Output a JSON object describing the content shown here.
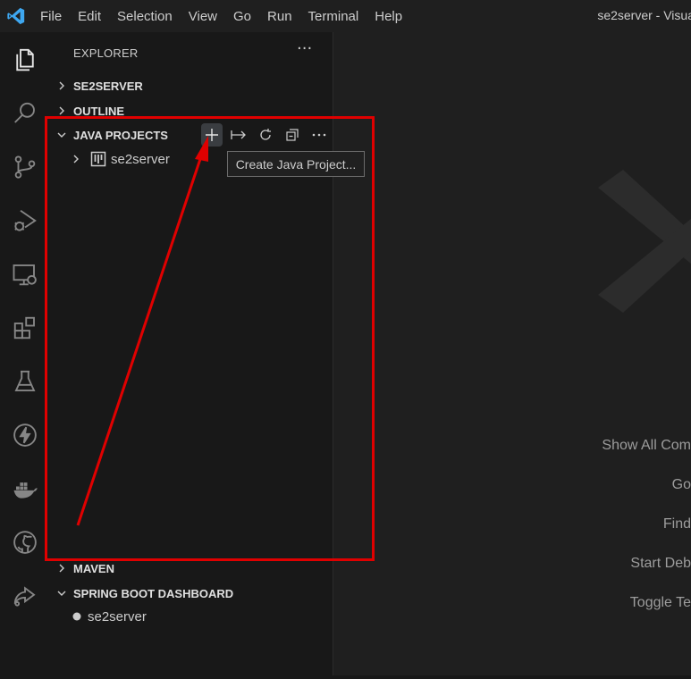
{
  "menu": [
    "File",
    "Edit",
    "Selection",
    "View",
    "Go",
    "Run",
    "Terminal",
    "Help"
  ],
  "window_title": "se2server - Visua",
  "activity_icons": [
    "explorer-icon",
    "search-icon",
    "source-control-icon",
    "run-debug-icon",
    "remote-explorer-icon",
    "extensions-icon",
    "testing-icon",
    "lightning-icon",
    "docker-icon",
    "github-icon",
    "live-share-icon"
  ],
  "sidebar": {
    "title": "EXPLORER",
    "more": "···",
    "sections": {
      "se2server": "SE2SERVER",
      "outline": "OUTLINE",
      "java_projects": "JAVA PROJECTS",
      "maven": "MAVEN",
      "spring_boot": "SPRING BOOT DASHBOARD"
    },
    "java_project_item": "se2server",
    "spring_item": "se2server",
    "java_actions": [
      "add-icon",
      "link-arrow-icon",
      "refresh-icon",
      "collapse-all-icon",
      "more-icon"
    ]
  },
  "tooltip": "Create Java Project...",
  "editor": {
    "shortcuts": [
      "Show All Com",
      "Go",
      "Find",
      "Start Deb",
      "Toggle Te"
    ]
  },
  "colors": {
    "accent_red": "#e00000",
    "vscode_blue": "#3ea7f0"
  }
}
